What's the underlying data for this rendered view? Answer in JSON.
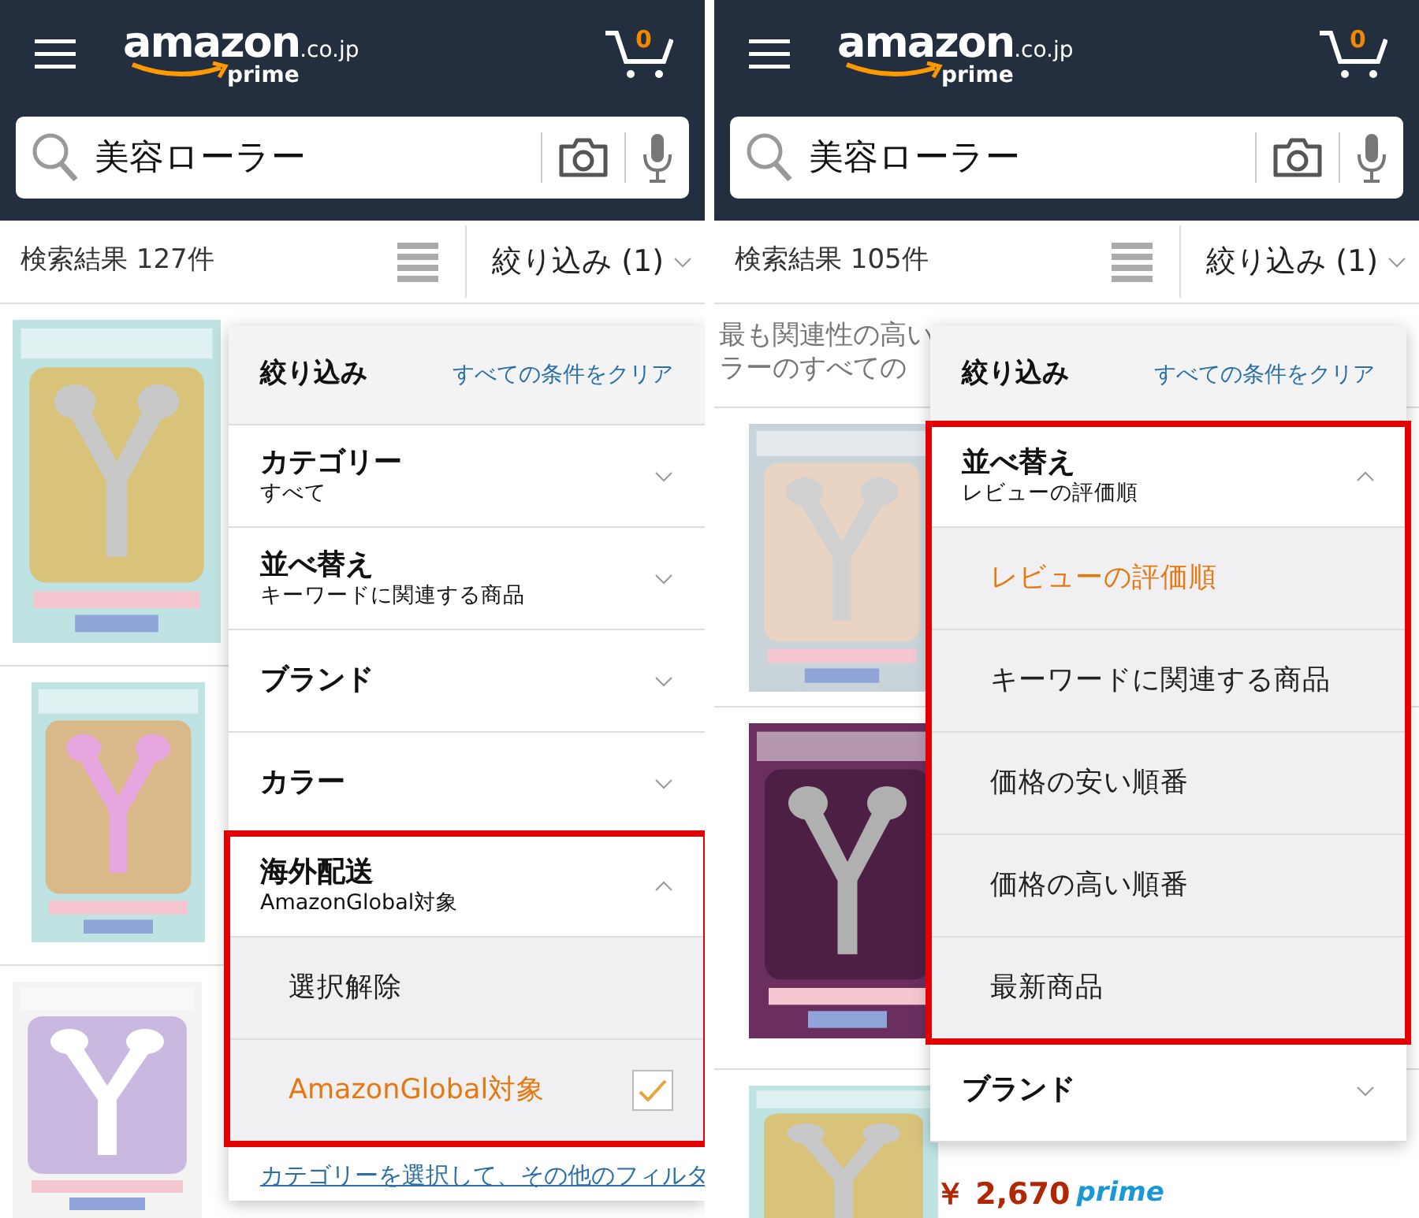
{
  "panes": [
    {
      "logo": {
        "brand": "amazon",
        "domain": ".co.jp",
        "tier": "prime"
      },
      "cart_count": "0",
      "search": {
        "value": "美容ローラー"
      },
      "results_count": "検索結果 127件",
      "filter_button": "絞り込み (1)",
      "products": [
        {
          "kind": "picture"
        },
        {
          "kind": "picture"
        },
        {
          "kind": "picture"
        }
      ],
      "filter_panel": {
        "title": "絞り込み",
        "clear_link": "すべての条件をクリア",
        "sections": [
          {
            "label": "カテゴリー",
            "value": "すべて",
            "expanded": false,
            "highlighted": false
          },
          {
            "label": "並べ替え",
            "value": "キーワードに関連する商品",
            "expanded": false,
            "highlighted": false
          },
          {
            "label": "ブランド",
            "expanded": false,
            "highlighted": false
          },
          {
            "label": "カラー",
            "expanded": false,
            "highlighted": false
          },
          {
            "label": "海外配送",
            "value": "AmazonGlobal対象",
            "expanded": true,
            "highlighted": true,
            "options": [
              {
                "kind": "action",
                "label": "選択解除"
              },
              {
                "kind": "checkbox",
                "label": "AmazonGlobal対象",
                "checked": true
              }
            ]
          }
        ],
        "footer_link": "カテゴリーを選択して、その他のフィルタ"
      }
    },
    {
      "logo": {
        "brand": "amazon",
        "domain": ".co.jp",
        "tier": "prime"
      },
      "cart_count": "0",
      "search": {
        "value": "美容ローラー"
      },
      "results_count": "検索結果 105件",
      "filter_button": "絞り込み (1)",
      "notice_lines": [
        "最も関連性の高い",
        "ラーのすべての"
      ],
      "products": [
        {
          "kind": "picture"
        },
        {
          "kind": "picture"
        },
        {
          "kind": "picture"
        }
      ],
      "price": {
        "amount": "￥ 2,670",
        "badge": "prime"
      },
      "filter_panel": {
        "title": "絞り込み",
        "clear_link": "すべての条件をクリア",
        "sections": [
          {
            "label": "並べ替え",
            "value": "レビューの評価順",
            "expanded": true,
            "highlighted": true,
            "options": [
              {
                "kind": "choice",
                "label": "レビューの評価順",
                "selected": true
              },
              {
                "kind": "choice",
                "label": "キーワードに関連する商品",
                "selected": false
              },
              {
                "kind": "choice",
                "label": "価格の安い順番",
                "selected": false
              },
              {
                "kind": "choice",
                "label": "価格の高い順番",
                "selected": false
              },
              {
                "kind": "choice",
                "label": "最新商品",
                "selected": false
              }
            ]
          },
          {
            "label": "ブランド",
            "expanded": false,
            "highlighted": false
          }
        ]
      }
    }
  ]
}
